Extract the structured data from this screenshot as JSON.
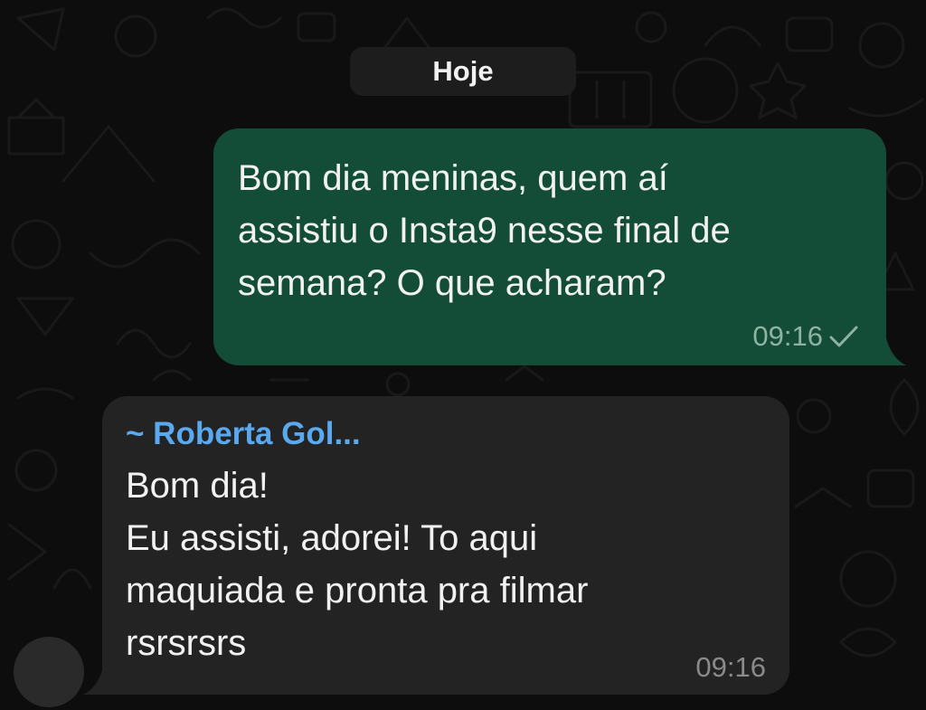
{
  "chat": {
    "date_separator": "Hoje",
    "messages": [
      {
        "direction": "outgoing",
        "text": "Bom dia meninas, quem aí\nassistiu o Insta9 nesse final de\nsemana? O que acharam?",
        "time": "09:16",
        "status_icon": "single-check-icon"
      },
      {
        "direction": "incoming",
        "sender": "~ Roberta Gol...",
        "text": "Bom dia!\nEu assisti, adorei! To aqui\nmaquiada e pronta pra filmar\nrsrsrsrs",
        "time": "09:16"
      }
    ]
  },
  "colors": {
    "outgoing_bubble": "#134d37",
    "incoming_bubble": "#232323",
    "sender_name": "#5aa9ee",
    "background": "#0d0d0d"
  }
}
